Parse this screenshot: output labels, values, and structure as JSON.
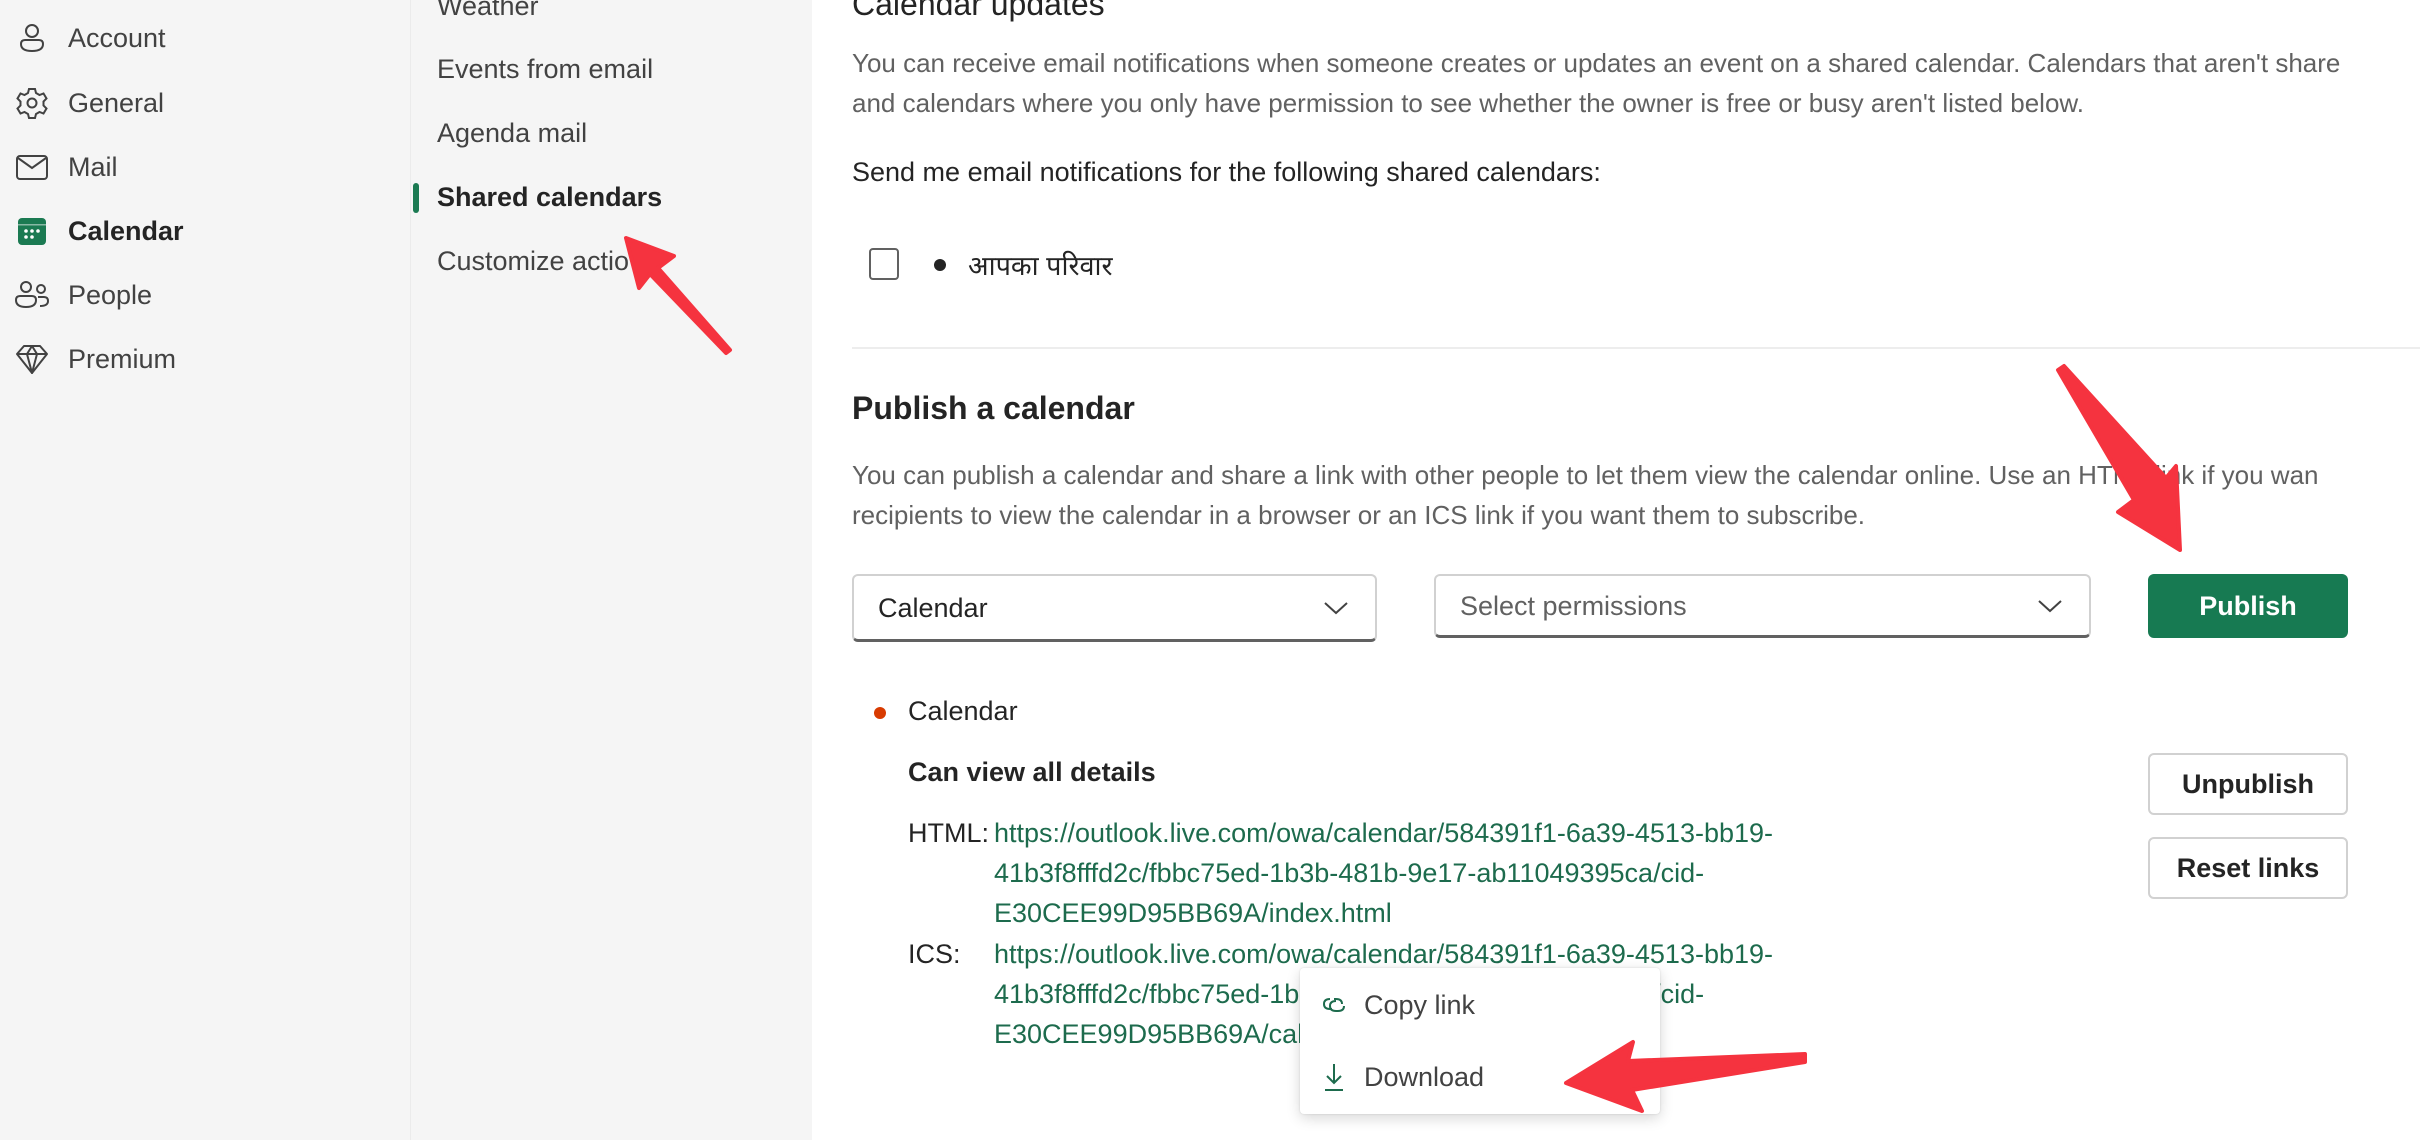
{
  "sidebar": {
    "items": [
      {
        "label": "Account",
        "icon": "person-icon",
        "active": false
      },
      {
        "label": "General",
        "icon": "gear-icon",
        "active": false
      },
      {
        "label": "Mail",
        "icon": "mail-icon",
        "active": false
      },
      {
        "label": "Calendar",
        "icon": "calendar-icon",
        "active": true
      },
      {
        "label": "People",
        "icon": "people-icon",
        "active": false
      },
      {
        "label": "Premium",
        "icon": "diamond-icon",
        "active": false
      }
    ]
  },
  "subnav": {
    "items": [
      {
        "label": "Weather",
        "active": false
      },
      {
        "label": "Events from email",
        "active": false
      },
      {
        "label": "Agenda mail",
        "active": false
      },
      {
        "label": "Shared calendars",
        "active": true
      },
      {
        "label": "Customize actio",
        "active": false
      }
    ]
  },
  "calendar_updates": {
    "title": "Calendar updates",
    "description_line1": "You can receive email notifications when someone creates or updates an event on a shared calendar. Calendars that aren't share",
    "description_line2": "and calendars where you only have permission to see whether the owner is free or busy aren't listed below.",
    "send_label": "Send me email notifications for the following shared calendars:",
    "calendars": [
      {
        "name": "आपका परिवार",
        "checked": false,
        "color": "#242424"
      }
    ]
  },
  "publish": {
    "title": "Publish a calendar",
    "description_line1": "You can publish a calendar and share a link with other people to let them view the calendar online. Use an HTML link if you wan",
    "description_line2": "recipients to view the calendar in a browser or an ICS link if you want them to subscribe.",
    "calendar_select": {
      "value": "Calendar"
    },
    "permissions_select": {
      "placeholder": "Select permissions"
    },
    "publish_button": "Publish",
    "published": {
      "calendar_name": "Calendar",
      "calendar_color": "#d83b01",
      "permission": "Can view all details",
      "html_label": "HTML:",
      "html_link_lines": [
        "https://outlook.live.com/owa/calendar/584391f1-6a39-4513-bb19-",
        "41b3f8fffd2c/fbbc75ed-1b3b-481b-9e17-ab11049395ca/cid-",
        "E30CEE99D95BB69A/index.html"
      ],
      "ics_label": "ICS:",
      "ics_link_lines": [
        "https://outlook.live.com/owa/calendar/584391f1-6a39-4513-bb19-",
        "41b3f8fffd2c/fbbc75ed-1b3b-481b-9e17-ab11049395ca/cid-",
        "E30CEE99D95BB69A/calendar.ics"
      ],
      "unpublish_button": "Unpublish",
      "reset_links_button": "Reset links"
    }
  },
  "context_menu": {
    "items": [
      {
        "label": "Copy link",
        "icon": "link-icon"
      },
      {
        "label": "Download",
        "icon": "download-icon"
      }
    ]
  },
  "colors": {
    "accent": "#177a52",
    "link": "#1d6b4d",
    "annotation_arrow": "#f5333f"
  }
}
